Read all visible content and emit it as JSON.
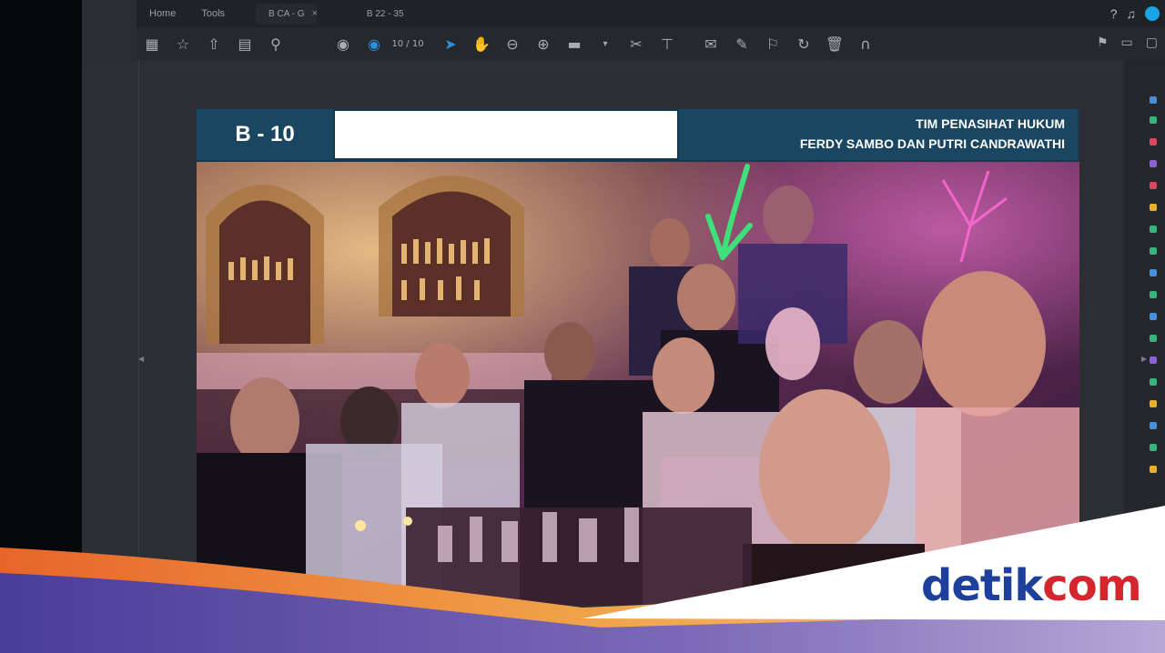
{
  "menubar": {
    "home": "Home",
    "tools": "Tools",
    "tab1": "B CA - G",
    "tab_close": "×",
    "tab2": "B 22 - 35"
  },
  "toolbar": {
    "page_indicator": "10 / 10"
  },
  "slide": {
    "code": "B - 10",
    "header_line1": "TIM PENASIHAT HUKUM",
    "header_line2": "FERDY SAMBO DAN PUTRI CANDRAWATHI"
  },
  "brand": {
    "logo_part1": "detik",
    "logo_part2": "com"
  },
  "colors": {
    "accent_blue": "#1aa6e6",
    "slide_header": "#1b4662",
    "logo_blue": "#1f3f9c",
    "logo_red": "#d5262f",
    "arrow_green": "#3ee07a"
  }
}
